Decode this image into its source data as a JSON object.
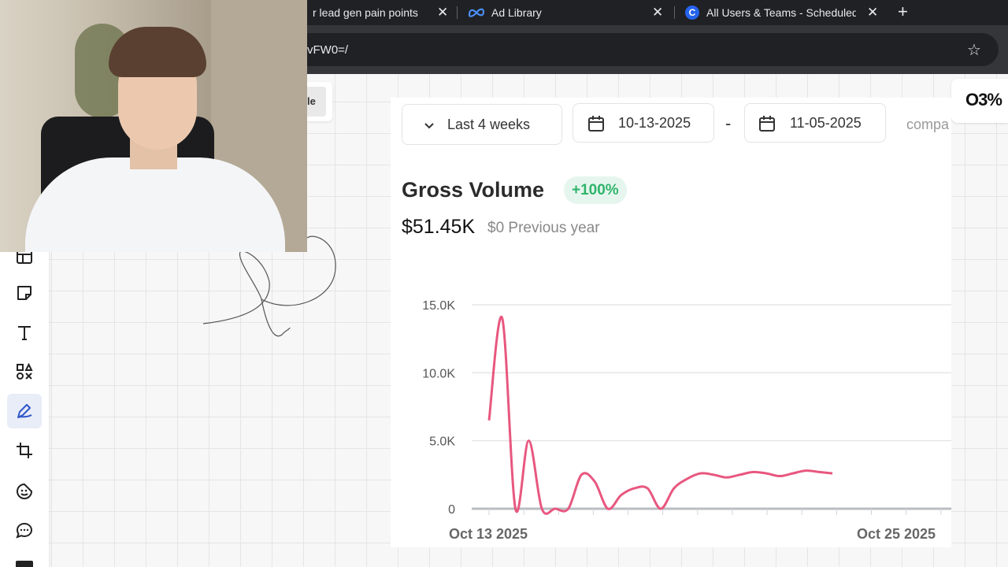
{
  "browser": {
    "tabs": [
      {
        "title": "r lead gen pain points"
      },
      {
        "title": "Ad Library"
      },
      {
        "title": "All Users & Teams - Scheduled"
      }
    ],
    "url": "vFW0=/"
  },
  "canvas": {
    "partial_button_label": "le",
    "logo_text": "O3%"
  },
  "dashboard": {
    "date_preset": "Last 4 weeks",
    "start_date": "10-13-2025",
    "end_date": "11-05-2025",
    "range_separator": "-",
    "compare_label": "compa",
    "metric": {
      "title": "Gross Volume",
      "change_badge": "+100%",
      "value": "$51.45K",
      "previous": "$0 Previous year"
    }
  },
  "colors": {
    "line": "#e8577f",
    "badge_bg": "#e6f6ee",
    "badge_text": "#2fb46b"
  },
  "chart_data": {
    "type": "line",
    "title": "",
    "xlabel": "",
    "ylabel": "",
    "x_tick_labels": [
      "Oct 13 2025",
      "Oct 25 2025"
    ],
    "y_tick_labels": [
      "0",
      "5.0K",
      "10.0K",
      "15.0K"
    ],
    "y_ticks": [
      0,
      5000,
      10000,
      15000
    ],
    "ylim": [
      0,
      15000
    ],
    "grid": true,
    "series": [
      {
        "x": [
          0,
          0.5,
          1,
          1.5,
          2,
          2.5,
          3,
          3.5,
          4,
          4.5,
          5,
          5.5,
          6,
          6.5,
          7,
          7.5,
          8,
          8.5,
          9,
          9.5,
          10,
          10.5,
          11,
          11.5,
          12,
          12.5,
          13
        ],
        "values": [
          6500,
          14000,
          0,
          5000,
          0,
          0,
          0,
          2500,
          2000,
          0,
          1000,
          1500,
          1500,
          0,
          1500,
          2200,
          2600,
          2500,
          2300,
          2500,
          2700,
          2600,
          2400,
          2600,
          2800,
          2700,
          2600
        ]
      }
    ]
  }
}
